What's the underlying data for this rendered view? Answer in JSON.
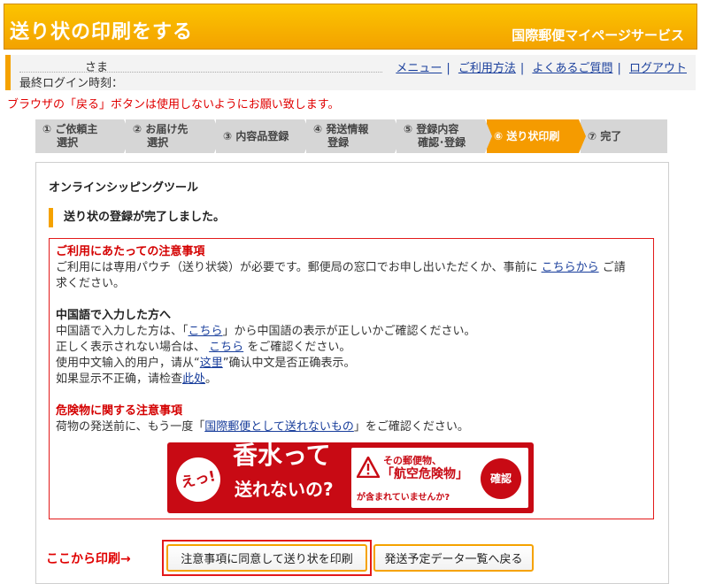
{
  "header": {
    "title": "送り状の印刷をする",
    "service": "国際郵便マイページサービス"
  },
  "user": {
    "name": "さま",
    "last_login": "最終ログイン時刻："
  },
  "nav_links": [
    "メニュー",
    "ご利用方法",
    "よくあるご質問",
    "ログアウト"
  ],
  "back_warning": "ブラウザの「戻る」ボタンは使用しないようにお願い致します。",
  "steps": [
    {
      "label": "① ご依頼主\n　 選択",
      "active": false
    },
    {
      "label": "② お届け先\n　 選択",
      "active": false
    },
    {
      "label": "③ 内容品登録",
      "active": false
    },
    {
      "label": "④ 発送情報\n　 登録",
      "active": false
    },
    {
      "label": "⑤ 登録内容\n　 確認･登録",
      "active": false
    },
    {
      "label": "⑥ 送り状印刷",
      "active": true
    },
    {
      "label": "⑦ 完了",
      "active": false
    }
  ],
  "main": {
    "tool_title": "オンラインシッピングツール",
    "done_message": "送り状の登録が完了しました。"
  },
  "notice": {
    "usage_heading": "ご利用にあたっての注意事項",
    "usage_text_1": "ご利用には専用パウチ（送り状袋）が必要です。郵便局の窓口でお申し出いただくか、事前に",
    "usage_link": "こちらから",
    "usage_text_2": "ご請",
    "usage_text_3": "求ください。",
    "chinese_heading": "中国語で入力した方へ",
    "chinese_l1_a": "中国語で入力した方は、「",
    "chinese_l1_link": "こちら",
    "chinese_l1_b": "」から中国語の表示が正しいかご確認ください。",
    "chinese_l2_a": "正しく表示されない場合は、",
    "chinese_l2_link": "こちら",
    "chinese_l2_b": "をご確認ください。",
    "chinese_l3_a": "使用中文输入的用户，请从“",
    "chinese_l3_link": "这里",
    "chinese_l3_b": "”确认中文是否正确表示。",
    "chinese_l4_a": "如果显示不正确，请检查",
    "chinese_l4_link": "此处",
    "chinese_l4_b": "。",
    "danger_heading": "危険物に関する注意事項",
    "danger_text_a": "荷物の発送前に、もう一度「",
    "danger_link": "国際郵便として送れないもの",
    "danger_text_b": "」をご確認ください。"
  },
  "banner": {
    "badge": "えっ!",
    "main_line1": "香水って",
    "main_line2": "送れないの?",
    "right_line1": "その郵便物、",
    "right_line2": "「航空危険物」",
    "right_line3": "が含まれていませんか?",
    "confirm": "確認"
  },
  "actions": {
    "print_here": "ここから印刷→",
    "print_button": "注意事項に同意して送り状を印刷",
    "back_button": "発送予定データ一覧へ戻る"
  },
  "colors": {
    "header_orange": "#f5a200",
    "active_step": "#f59b00",
    "alert_red": "#e31a1a",
    "link_blue": "#1a3f9c"
  }
}
